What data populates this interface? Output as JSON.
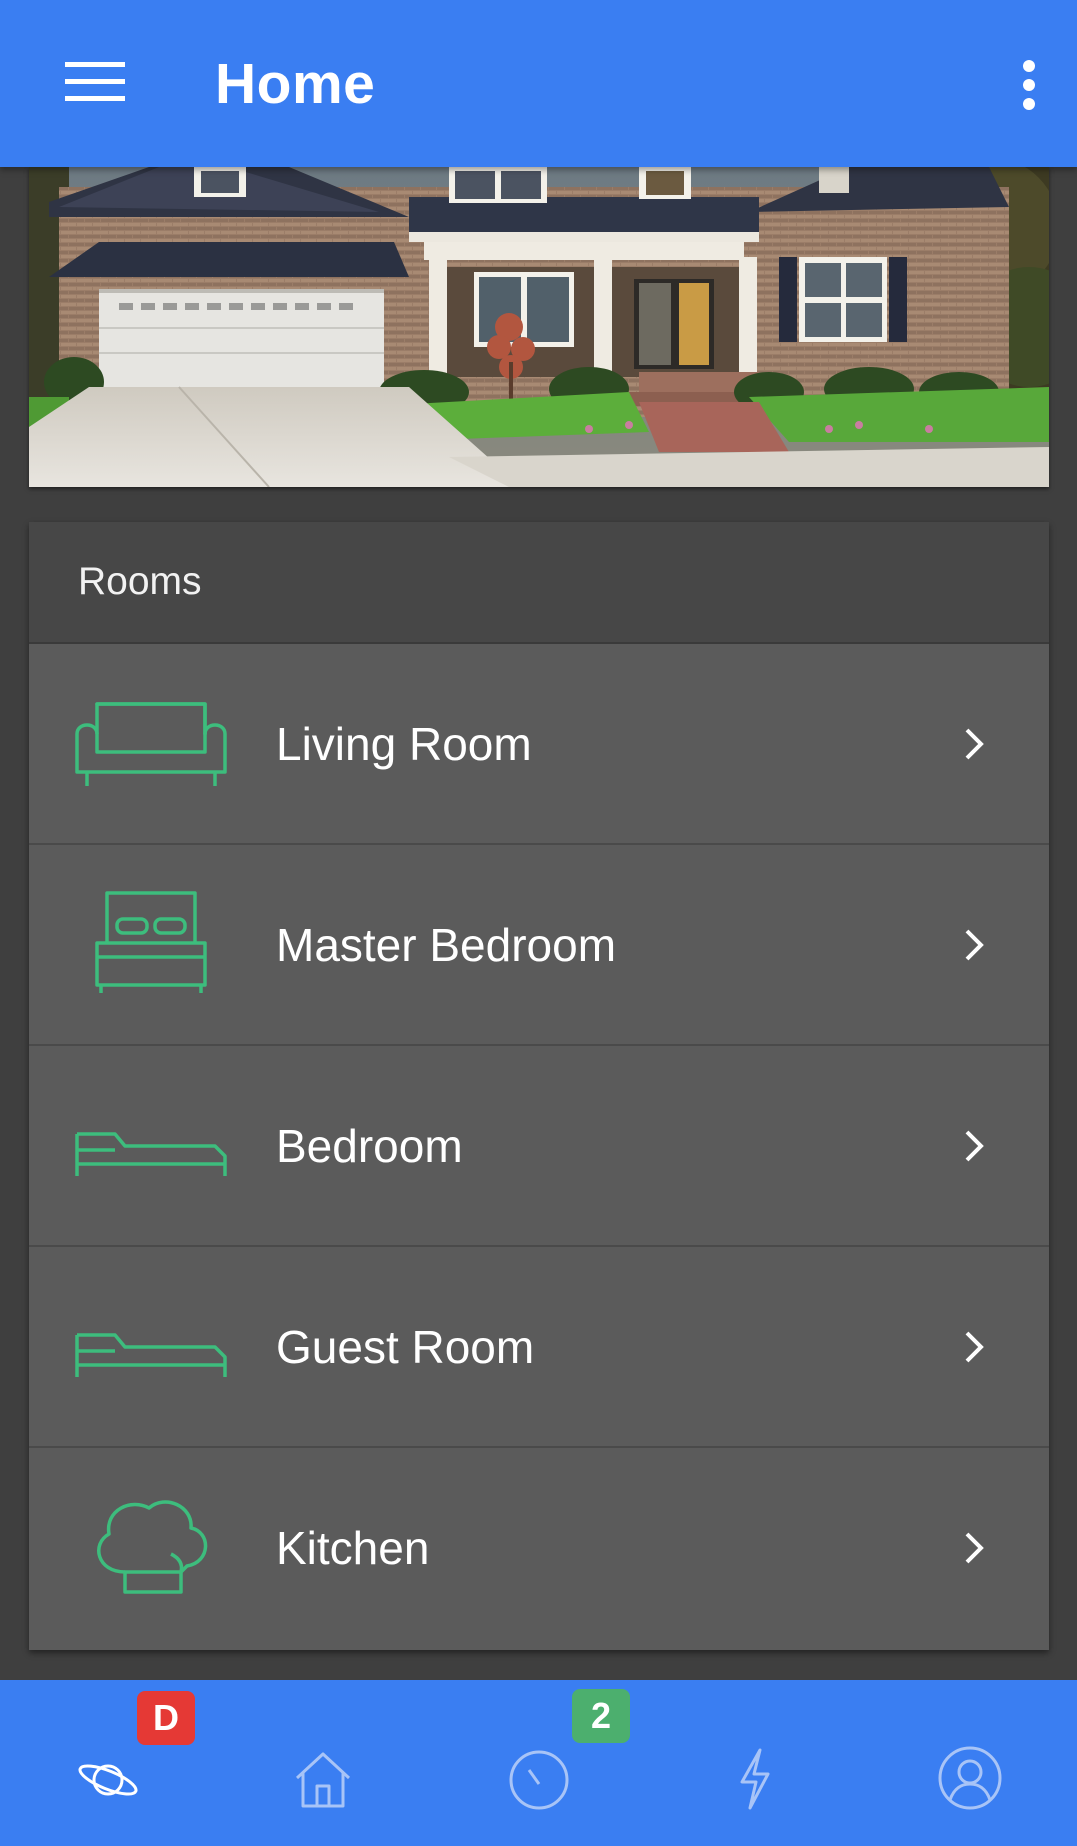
{
  "appbar": {
    "title": "Home",
    "menu_icon": "hamburger-menu-icon",
    "overflow_icon": "more-vert-icon"
  },
  "hero": {
    "image": "house-exterior-photo"
  },
  "rooms": {
    "header": "Rooms",
    "items": [
      {
        "label": "Living Room",
        "icon": "sofa-icon"
      },
      {
        "label": "Master Bedroom",
        "icon": "double-bed-icon"
      },
      {
        "label": "Bedroom",
        "icon": "single-bed-icon"
      },
      {
        "label": "Guest Room",
        "icon": "single-bed-icon"
      },
      {
        "label": "Kitchen",
        "icon": "chef-hat-icon"
      }
    ]
  },
  "bottomnav": {
    "items": [
      {
        "icon": "planet-icon",
        "badge": "D",
        "badge_color": "#e53935"
      },
      {
        "icon": "house-icon"
      },
      {
        "icon": "timer-icon",
        "badge": "2",
        "badge_color": "#4caf6e"
      },
      {
        "icon": "lightning-icon"
      },
      {
        "icon": "user-avatar-icon"
      }
    ]
  },
  "colors": {
    "primary": "#3a7ef2",
    "icon_accent": "#3dbd7d",
    "card_bg": "#5b5b5b",
    "header_bg": "#474747",
    "page_bg": "#3f3f3f"
  }
}
